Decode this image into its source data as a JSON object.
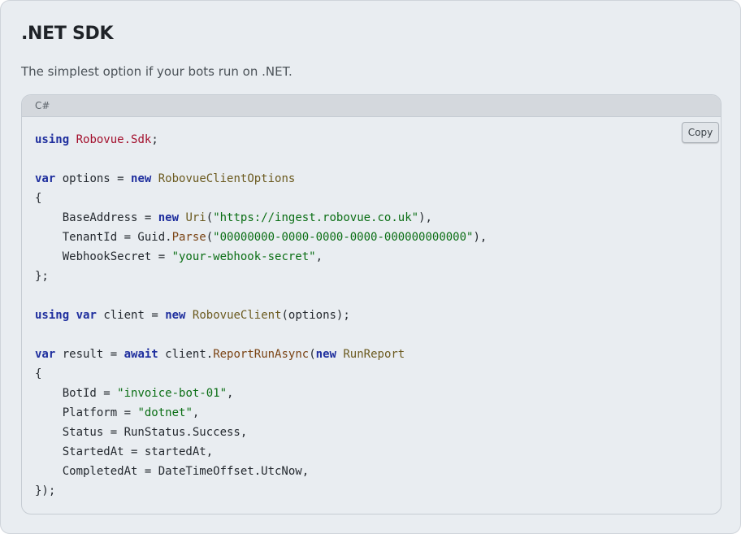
{
  "title": ".NET SDK",
  "description": "The simplest option if your bots run on .NET.",
  "code": {
    "language": "C#",
    "copy_label": "Copy",
    "lines": [
      [
        [
          "kw",
          "using"
        ],
        [
          "",
          " "
        ],
        [
          "ns",
          "Robovue.Sdk"
        ],
        [
          "",
          ";"
        ]
      ],
      [],
      [
        [
          "kw",
          "var"
        ],
        [
          "",
          " options = "
        ],
        [
          "kw",
          "new"
        ],
        [
          "",
          " "
        ],
        [
          "ty",
          "RobovueClientOptions"
        ]
      ],
      [
        [
          "",
          "{"
        ]
      ],
      [
        [
          "",
          "    BaseAddress = "
        ],
        [
          "kw",
          "new"
        ],
        [
          "",
          " "
        ],
        [
          "ty",
          "Uri"
        ],
        [
          "",
          "("
        ],
        [
          "str",
          "\"https://ingest.robovue.co.uk\""
        ],
        [
          "",
          "),"
        ]
      ],
      [
        [
          "",
          "    TenantId = Guid."
        ],
        [
          "fn",
          "Parse"
        ],
        [
          "",
          "("
        ],
        [
          "str",
          "\"00000000-0000-0000-0000-000000000000\""
        ],
        [
          "",
          "),"
        ]
      ],
      [
        [
          "",
          "    WebhookSecret = "
        ],
        [
          "str",
          "\"your-webhook-secret\""
        ],
        [
          "",
          ","
        ]
      ],
      [
        [
          "",
          "};"
        ]
      ],
      [],
      [
        [
          "kw",
          "using"
        ],
        [
          "",
          " "
        ],
        [
          "kw",
          "var"
        ],
        [
          "",
          " client = "
        ],
        [
          "kw",
          "new"
        ],
        [
          "",
          " "
        ],
        [
          "ty",
          "RobovueClient"
        ],
        [
          "",
          "(options);"
        ]
      ],
      [],
      [
        [
          "kw",
          "var"
        ],
        [
          "",
          " result = "
        ],
        [
          "kw",
          "await"
        ],
        [
          "",
          " client."
        ],
        [
          "fn",
          "ReportRunAsync"
        ],
        [
          "",
          "("
        ],
        [
          "kw",
          "new"
        ],
        [
          "",
          " "
        ],
        [
          "ty",
          "RunReport"
        ]
      ],
      [
        [
          "",
          "{"
        ]
      ],
      [
        [
          "",
          "    BotId = "
        ],
        [
          "str",
          "\"invoice-bot-01\""
        ],
        [
          "",
          ","
        ]
      ],
      [
        [
          "",
          "    Platform = "
        ],
        [
          "str",
          "\"dotnet\""
        ],
        [
          "",
          ","
        ]
      ],
      [
        [
          "",
          "    Status = RunStatus.Success,"
        ]
      ],
      [
        [
          "",
          "    StartedAt = startedAt,"
        ]
      ],
      [
        [
          "",
          "    CompletedAt = DateTimeOffset.UtcNow,"
        ]
      ],
      [
        [
          "",
          "});"
        ]
      ]
    ]
  }
}
